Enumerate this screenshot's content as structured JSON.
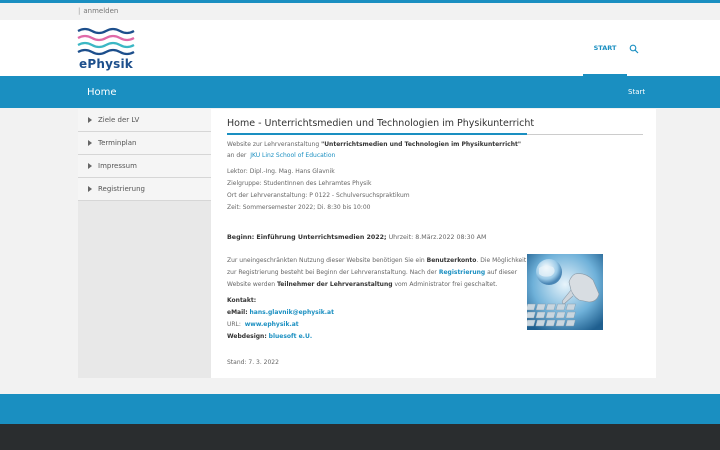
{
  "topbar": {
    "separator": "|",
    "login_label": "anmelden"
  },
  "logo": {
    "text": "ePhysik"
  },
  "nav": {
    "start_label": "START",
    "search_icon": "search-icon"
  },
  "banner": {
    "title": "Home",
    "breadcrumb": "Start"
  },
  "sidebar": {
    "items": [
      {
        "label": "Ziele der LV"
      },
      {
        "label": "Terminplan"
      },
      {
        "label": "Impressum"
      },
      {
        "label": "Registrierung"
      }
    ]
  },
  "content": {
    "heading": "Home - Unterrichtsmedien und Technologien im Physikunterricht",
    "intro_prefix": "Website zur Lehrveranstaltung",
    "intro_course": "\"Unterrichtsmedien und Technologien im Physikunterricht\"",
    "intro_at": "an der",
    "intro_school": "JKU Linz School of Education",
    "lektor": "Lektor: Dipl.-Ing. Mag. Hans Glavnik",
    "zielgruppe": "Zielgruppe: StudentInnen des Lehramtes Physik",
    "ort": "Ort der Lehrveranstaltung: P 0122 - Schulversuchspraktikum",
    "zeit": "Zeit: Sommersemester 2022; Di. 8:30 bis 10:00",
    "beginn_bold": "Beginn: Einführung Unterrichtsmedien 2022;",
    "beginn_time": "Uhrzeit: 8.März.2022 08:30 AM",
    "para1_a": "Zur uneingeschränkten  Nutzung dieser Website benötigen Sie ein",
    "para1_b": "Benutzerkonto",
    "para1_c": ". Die Möglichkeit",
    "para2_a": "zur Registrierung besteht bei Beginn der Lehrveranstaltung. Nach der",
    "para2_b": "Registrierung",
    "para2_c": "auf dieser",
    "para3_a": "Website werden",
    "para3_b": "Teilnehmer der Lehrveranstaltung",
    "para3_c": "vom Administrator frei geschaltet.",
    "kontakt": "Kontakt:",
    "email_label": "eMail:",
    "email_value": "hans.glavnik@ephysik.at",
    "url_label": "URL:",
    "url_value": "www.ephysik.at",
    "webdesign_label": "Webdesign:",
    "webdesign_value": "bluesoft e.U.",
    "stand": "Stand: 7. 3. 2022"
  },
  "colors": {
    "accent": "#1a8fc1",
    "footer": "#2a2d2f",
    "logo_blue": "#1d4f8c",
    "logo_pink": "#e06aa8",
    "logo_teal": "#3bb7c4"
  }
}
